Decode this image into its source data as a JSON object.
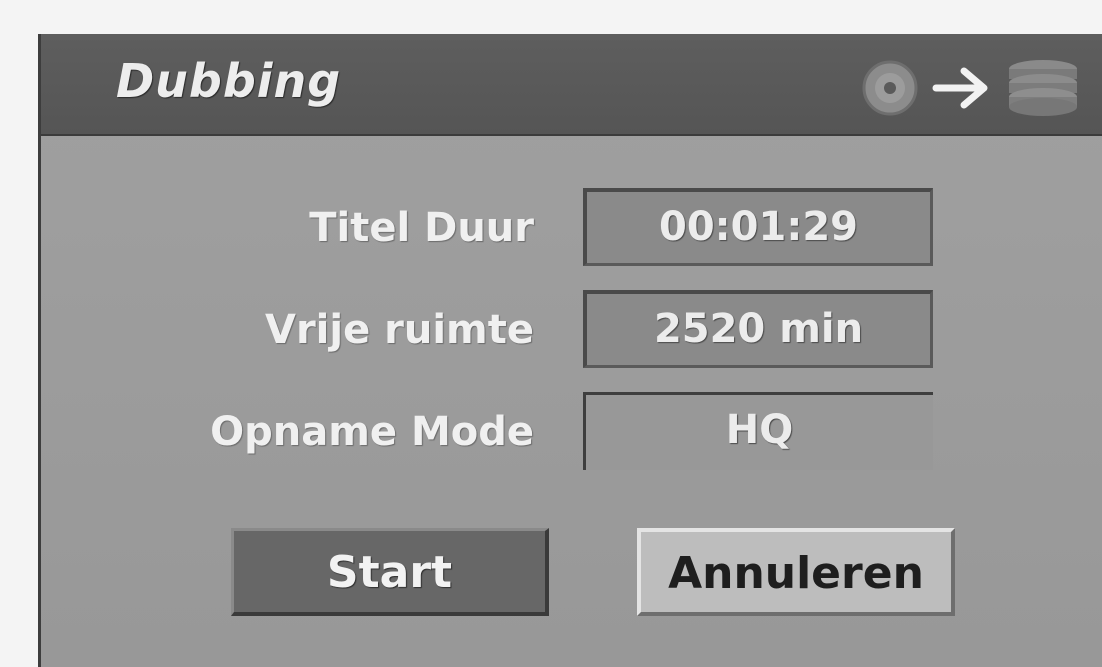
{
  "dialog": {
    "title": "Dubbing",
    "icons": [
      "disc-icon",
      "arrow-right-icon",
      "hdd-stack-icon"
    ]
  },
  "fields": [
    {
      "label": "Titel Duur",
      "value": "00:01:29"
    },
    {
      "label": "Vrije ruimte",
      "value": "2520 min"
    },
    {
      "label": "Opname Mode",
      "value": "HQ"
    }
  ],
  "buttons": {
    "start": "Start",
    "cancel": "Annuleren"
  }
}
